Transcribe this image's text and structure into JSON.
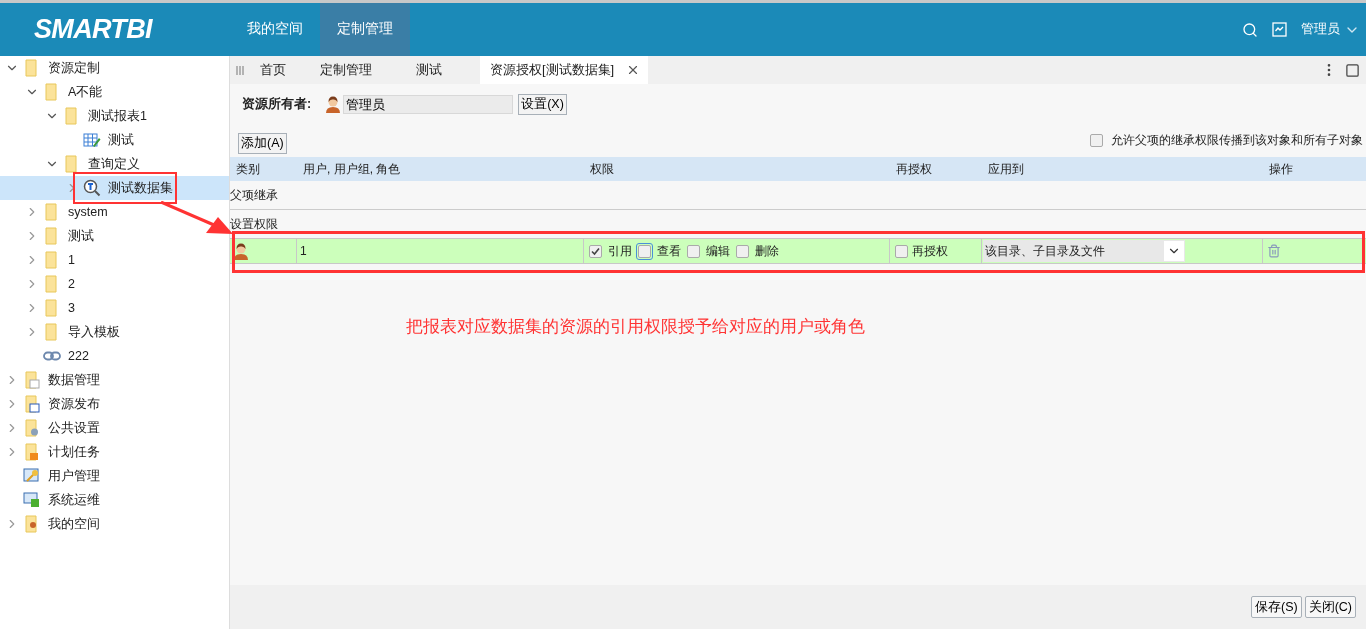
{
  "header": {
    "logo": "SMARTBI",
    "nav": [
      {
        "label": "我的空间",
        "selected": false
      },
      {
        "label": "定制管理",
        "selected": true
      }
    ],
    "user": "管理员"
  },
  "tree": [
    {
      "label": "资源定制",
      "kind": "folder",
      "expanded": true,
      "selected": false,
      "children": [
        {
          "label": "A不能",
          "kind": "folder",
          "expanded": true,
          "selected": false,
          "children": [
            {
              "label": "测试报表1",
              "kind": "folder",
              "expanded": true,
              "selected": false,
              "children": [
                {
                  "label": "测试",
                  "kind": "report",
                  "selected": false
                }
              ]
            },
            {
              "label": "查询定义",
              "kind": "folder",
              "expanded": true,
              "selected": false,
              "children": [
                {
                  "label": "测试数据集",
                  "kind": "query",
                  "expanded": false,
                  "selected": true
                }
              ]
            }
          ]
        },
        {
          "label": "system",
          "kind": "folder",
          "expanded": false,
          "selected": false
        },
        {
          "label": "测试",
          "kind": "folder",
          "expanded": false,
          "selected": false
        },
        {
          "label": "1",
          "kind": "folder",
          "expanded": false,
          "selected": false
        },
        {
          "label": "2",
          "kind": "folder",
          "expanded": false,
          "selected": false
        },
        {
          "label": "3",
          "kind": "folder",
          "expanded": false,
          "selected": false
        },
        {
          "label": "导入模板",
          "kind": "folder",
          "expanded": false,
          "selected": false
        },
        {
          "label": "222",
          "kind": "link",
          "selected": false
        }
      ]
    },
    {
      "label": "数据管理",
      "kind": "data",
      "expanded": false,
      "selected": false
    },
    {
      "label": "资源发布",
      "kind": "publish",
      "expanded": false,
      "selected": false
    },
    {
      "label": "公共设置",
      "kind": "settings",
      "expanded": false,
      "selected": false
    },
    {
      "label": "计划任务",
      "kind": "task",
      "expanded": false,
      "selected": false
    },
    {
      "label": "用户管理",
      "kind": "users",
      "selected": false
    },
    {
      "label": "系统运维",
      "kind": "ops",
      "selected": false
    },
    {
      "label": "我的空间",
      "kind": "person",
      "expanded": false,
      "selected": false
    }
  ],
  "tabs": [
    {
      "label": "首页",
      "selected": false,
      "closable": false
    },
    {
      "label": "定制管理",
      "selected": false,
      "closable": false
    },
    {
      "label": "测试",
      "selected": false,
      "closable": false
    },
    {
      "label": "资源授权[测试数据集]",
      "selected": true,
      "closable": true
    }
  ],
  "owner": {
    "label": "资源所有者:",
    "value": "管理员",
    "button": "设置(X)"
  },
  "add_button": "添加(A)",
  "propagate": {
    "label": "允许父项的继承权限传播到该对象和所有子对象",
    "checked": false
  },
  "table": {
    "columns": [
      "类别",
      "用户, 用户组, 角色",
      "权限",
      "再授权",
      "应用到",
      "操作"
    ],
    "sections": [
      {
        "title": "父项继承"
      },
      {
        "title": "设置权限",
        "rows": [
          {
            "user": "1",
            "permissions": [
              {
                "label": "引用",
                "checked": true,
                "focused": false
              },
              {
                "label": "查看",
                "checked": false,
                "focused": true
              },
              {
                "label": "编辑",
                "checked": false,
                "focused": false
              },
              {
                "label": "删除",
                "checked": false,
                "focused": false
              }
            ],
            "regrant": {
              "label": "再授权",
              "checked": false
            },
            "apply_to": "该目录、子目录及文件"
          }
        ]
      }
    ]
  },
  "annotation": "把报表对应数据集的资源的引用权限授予给对应的用户或角色",
  "footer_buttons": [
    "保存(S)",
    "关闭(C)"
  ]
}
